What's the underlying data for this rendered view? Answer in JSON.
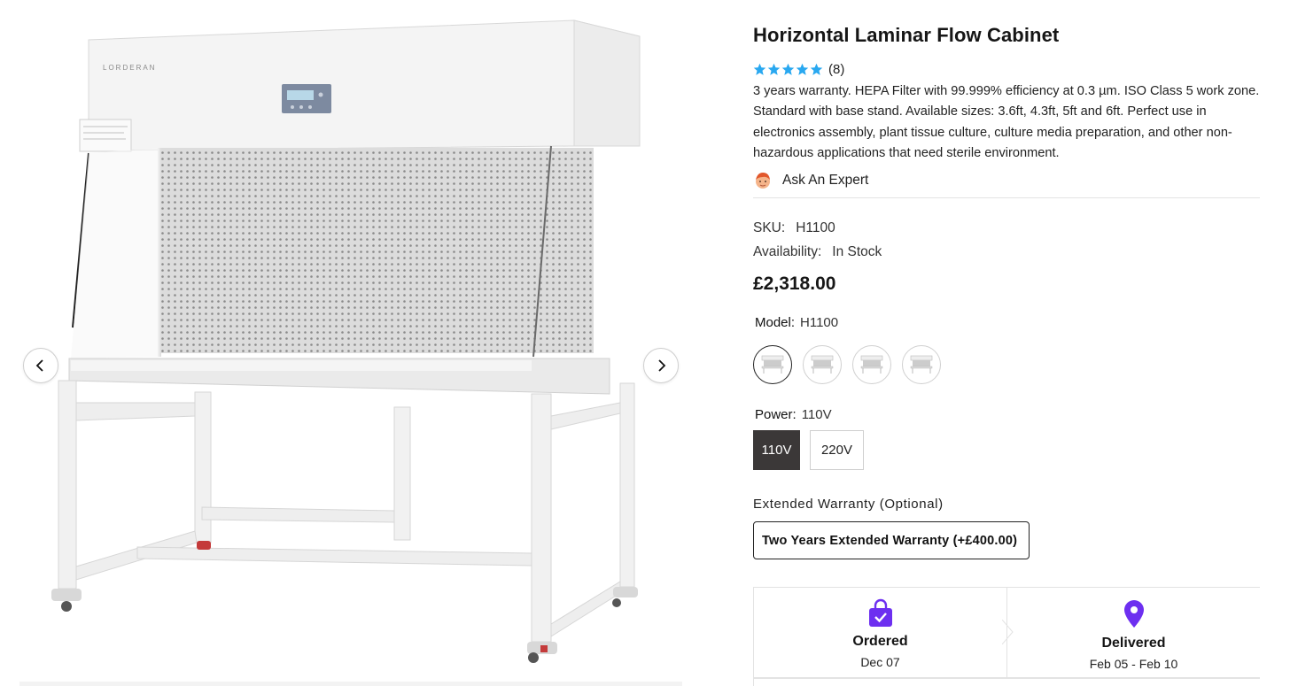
{
  "product": {
    "title": "Horizontal Laminar Flow Cabinet",
    "rating_stars": 5,
    "review_count": "(8)",
    "description": "3 years warranty. HEPA Filter with 99.999% efficiency at 0.3 µm. ISO Class 5 work zone. Standard with base stand. Available sizes: 3.6ft, 4.3ft, 5ft and 6ft. Perfect use in electronics assembly, plant tissue culture, culture media preparation, and other non-hazardous applications that need sterile environment.",
    "ask_expert": "Ask An Expert",
    "sku_label": "SKU:",
    "sku_value": "H1100",
    "availability_label": "Availability:",
    "availability_value": "In Stock",
    "price": "£2,318.00",
    "brand_on_image": "LORDERAN"
  },
  "model": {
    "label": "Model:",
    "selected": "H1100",
    "option_count": 4
  },
  "power": {
    "label": "Power:",
    "selected": "110V",
    "options": [
      "110V",
      "220V"
    ]
  },
  "warranty": {
    "title": "Extended Warranty (Optional)",
    "option": "Two Years Extended Warranty (+£400.00)"
  },
  "delivery": {
    "ordered_title": "Ordered",
    "ordered_date": "Dec 07",
    "delivered_title": "Delivered",
    "delivered_date": "Feb 05 - Feb 10"
  },
  "colors": {
    "star": "#29a8f0",
    "accent": "#6d2ff0",
    "selected_button": "#3b3838"
  }
}
